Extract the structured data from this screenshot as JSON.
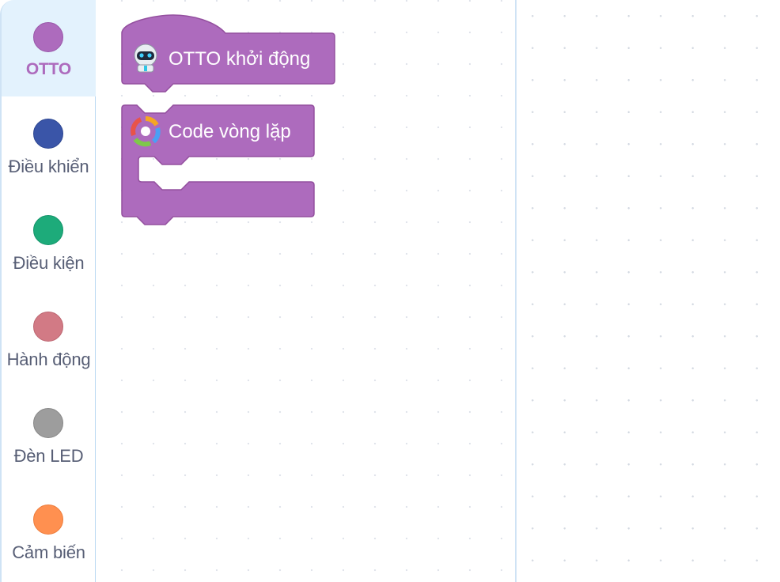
{
  "categories": [
    {
      "label": "OTTO",
      "color": "#ad6bbd",
      "border": "#9a58aa",
      "selected": true
    },
    {
      "label": "Điều khiển",
      "color": "#3a55a8",
      "border": "#2e4792",
      "selected": false
    },
    {
      "label": "Điều kiện",
      "color": "#1dab7a",
      "border": "#13946a",
      "selected": false
    },
    {
      "label": "Hành động",
      "color": "#d27a85",
      "border": "#bd6671",
      "selected": false
    },
    {
      "label": "Đèn LED",
      "color": "#9d9d9d",
      "border": "#888888",
      "selected": false
    },
    {
      "label": "Cảm biến",
      "color": "#ff9050",
      "border": "#ee7d3c",
      "selected": false
    }
  ],
  "blocks": {
    "start": {
      "label": "OTTO khởi động",
      "icon": "robot-icon",
      "color": "#ad6bbd",
      "border": "#94509f"
    },
    "loop": {
      "label": "Code vòng lặp",
      "icon": "refresh-cycle-icon",
      "color": "#ad6bbd",
      "border": "#94509f"
    }
  }
}
